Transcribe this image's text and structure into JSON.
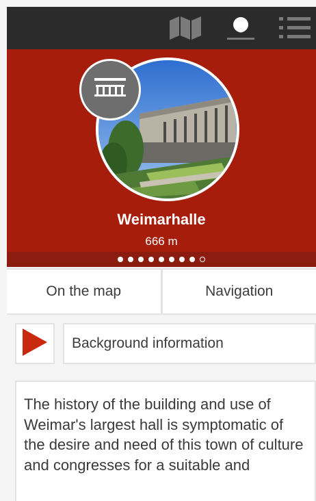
{
  "toolbar": {
    "icons": [
      "map-icon",
      "location-pin-icon",
      "list-menu-icon"
    ],
    "background": "#2b2b2b",
    "icon_color": "#7a7a7a"
  },
  "hero": {
    "title": "Weimarhalle",
    "distance": "666 m",
    "background": "#a71d0c",
    "category_icon": "railing-building-icon",
    "pager": {
      "total": 9,
      "active_index": 8
    }
  },
  "actions": {
    "map_label": "On the map",
    "navigation_label": "Navigation"
  },
  "audio": {
    "play_icon": "play-icon",
    "label": "Background information",
    "play_color": "#c8290f"
  },
  "description": {
    "text": "The history of the building and use of Weimar's largest hall is symptomatic of the desire and need of this town of culture and congresses for a suitable and"
  }
}
